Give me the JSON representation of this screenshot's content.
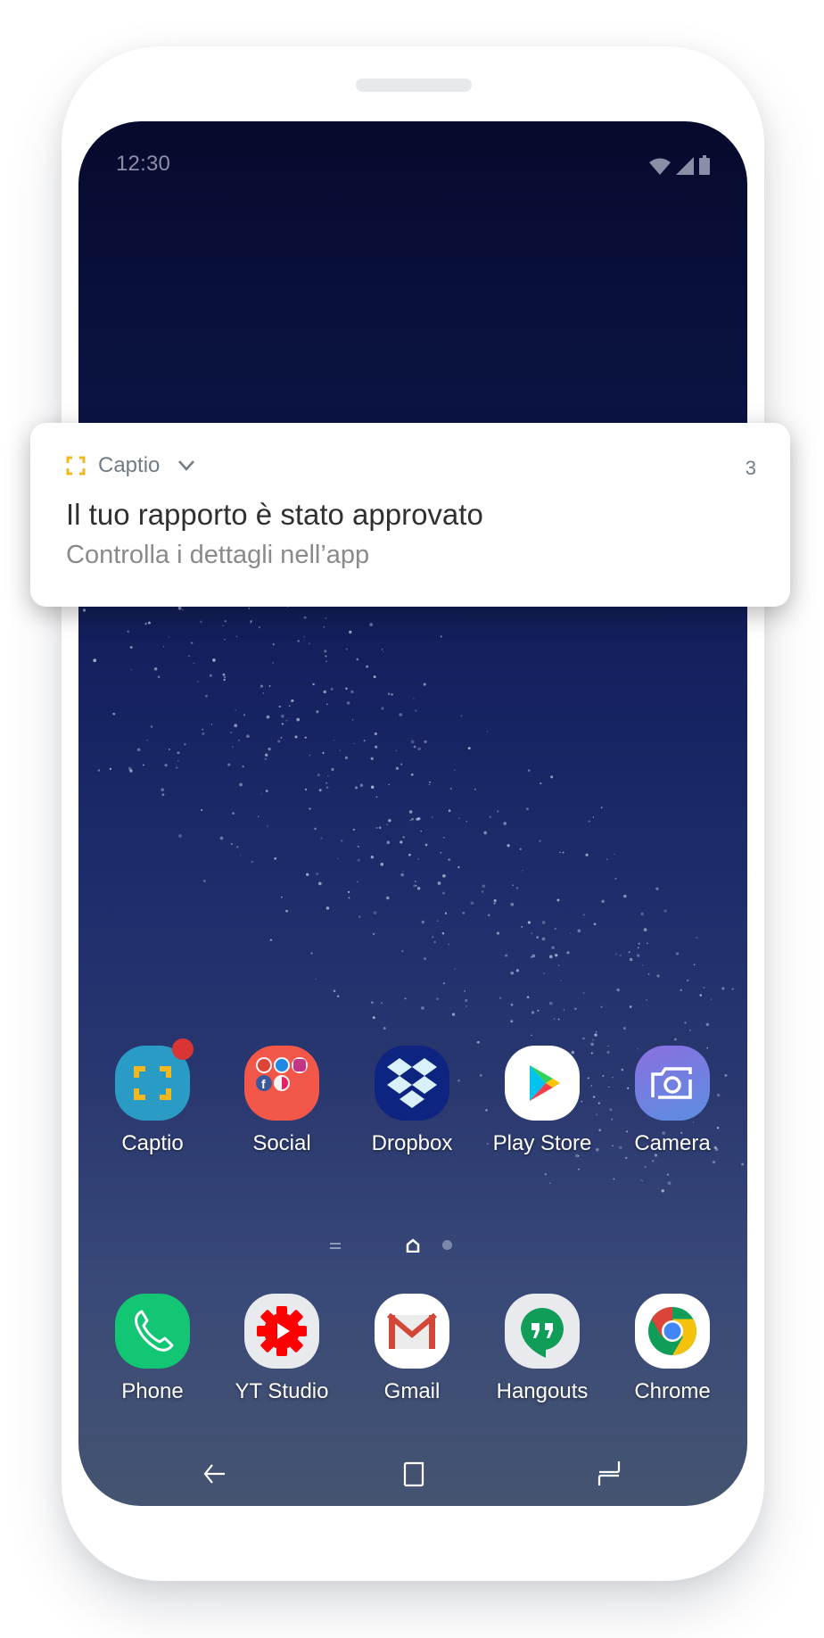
{
  "status_bar": {
    "time": "12:30",
    "icons": [
      "wifi-icon",
      "signal-icon",
      "battery-icon"
    ]
  },
  "notification": {
    "app_icon": "captio-frame-icon",
    "app_name": "Captio",
    "expand_icon": "chevron-down-icon",
    "count": "3",
    "title": "Il tuo rapporto è stato approvato",
    "body": "Controlla i dettagli nell’app",
    "accent_color": "#f5b81c"
  },
  "home_apps": [
    {
      "label": "Captio",
      "icon": "captio-icon",
      "color": "#2a9bc4",
      "badge": true
    },
    {
      "label": "Social",
      "icon": "social-folder-icon",
      "color": "#f2574a",
      "badge": false
    },
    {
      "label": "Dropbox",
      "icon": "dropbox-icon",
      "color": "#0d2481",
      "badge": false
    },
    {
      "label": "Play Store",
      "icon": "play-store-icon",
      "color": "#ffffff",
      "badge": false
    },
    {
      "label": "Camera",
      "icon": "camera-icon",
      "color": "#6c6fe0",
      "badge": false
    }
  ],
  "page_indicator": {
    "items": [
      "apps-menu-icon",
      "home-page-icon",
      "page-dot-icon"
    ],
    "active": 1
  },
  "dock_apps": [
    {
      "label": "Phone",
      "icon": "phone-icon",
      "color": "#12c673"
    },
    {
      "label": "YT Studio",
      "icon": "yt-studio-icon",
      "color": "#e9eaee"
    },
    {
      "label": "Gmail",
      "icon": "gmail-icon",
      "color": "#ffffff"
    },
    {
      "label": "Hangouts",
      "icon": "hangouts-icon",
      "color": "#e9eaee"
    },
    {
      "label": "Chrome",
      "icon": "chrome-icon",
      "color": "#ffffff"
    }
  ],
  "nav_bar": {
    "buttons": [
      "back-icon",
      "home-icon",
      "recents-icon"
    ]
  }
}
